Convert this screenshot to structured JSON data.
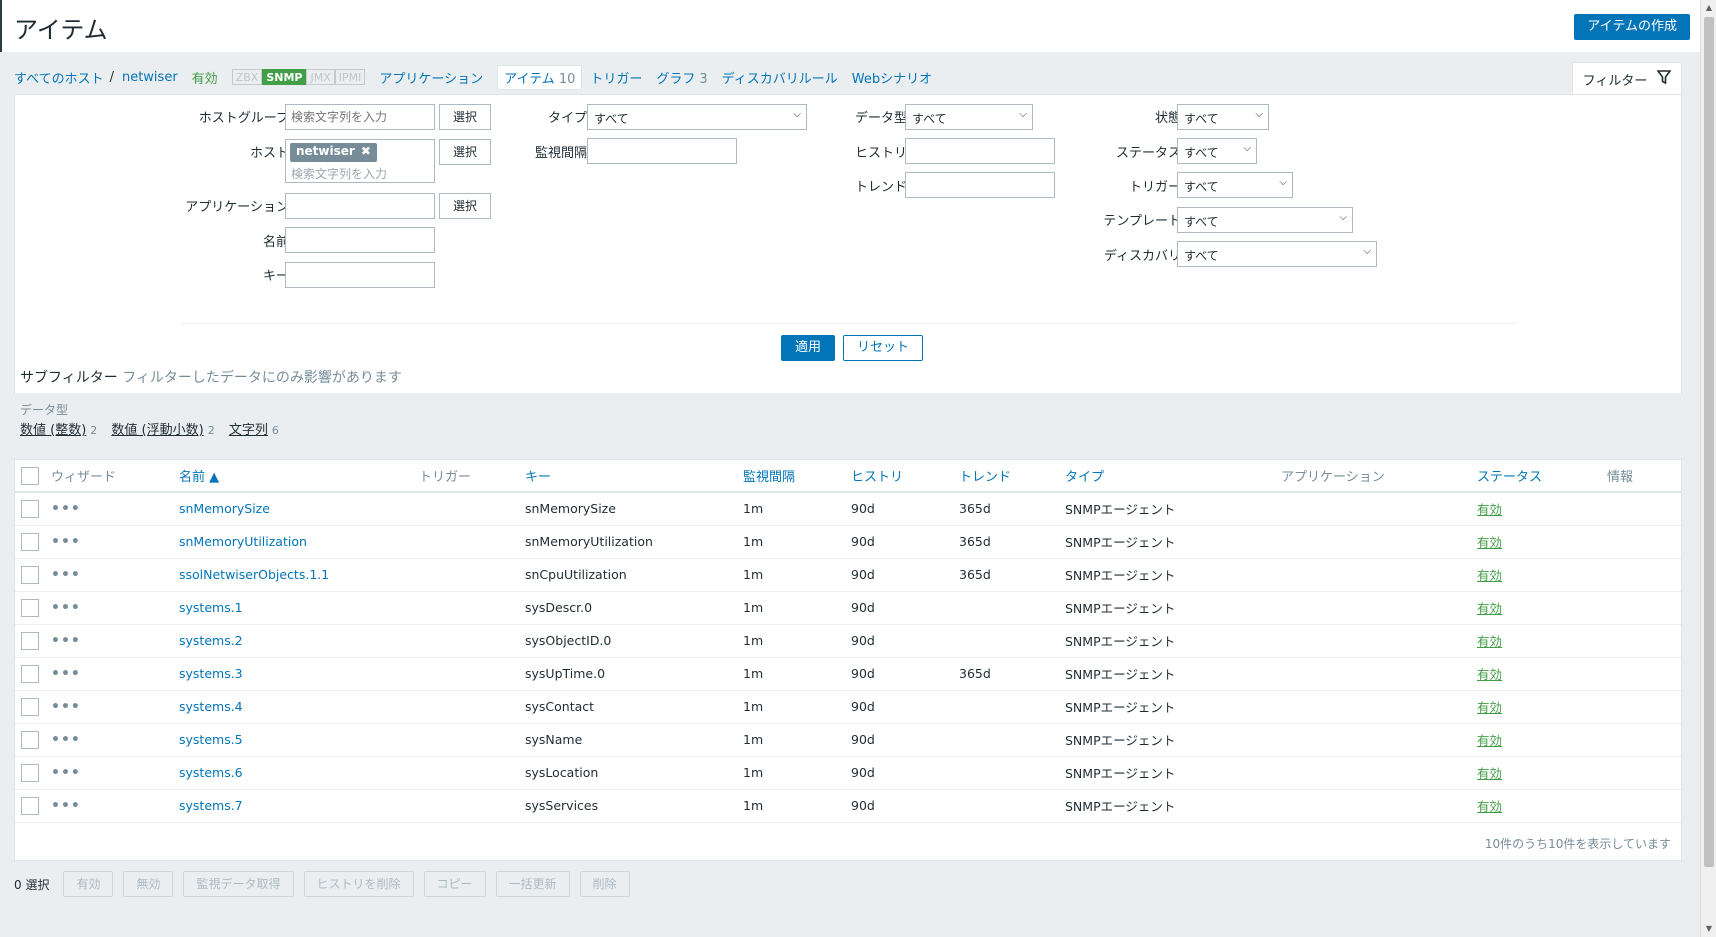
{
  "header": {
    "title": "アイテム",
    "create_button": "アイテムの作成"
  },
  "nav": {
    "all_hosts": "すべてのホスト",
    "separator": "/",
    "host": "netwiser",
    "status": "有効",
    "availability": [
      "ZBX",
      "SNMP",
      "JMX",
      "IPMI"
    ],
    "applications": "アプリケーション",
    "items": "アイテム",
    "items_count": "10",
    "triggers": "トリガー",
    "graphs": "グラフ",
    "graphs_count": "3",
    "discovery": "ディスカバリルール",
    "web": "Webシナリオ"
  },
  "filter": {
    "tab_label": "フィルター",
    "hostgroup_label": "ホストグループ",
    "hostgroup_placeholder": "検索文字列を入力",
    "host_label": "ホスト",
    "host_tag": "netwiser",
    "host_placeholder": "検索文字列を入力",
    "application_label": "アプリケーション",
    "name_label": "名前",
    "key_label": "キー",
    "select_button": "選択",
    "type_label": "タイプ",
    "type_value": "すべて",
    "interval_label": "監視間隔",
    "datatype_label": "データ型",
    "datatype_value": "すべて",
    "history_label": "ヒストリ",
    "trend_label": "トレンド",
    "state_label": "状態",
    "state_value": "すべて",
    "status_label": "ステータス",
    "status_value": "すべて",
    "triggers_label": "トリガー",
    "triggers_value": "すべて",
    "template_label": "テンプレート",
    "template_value": "すべて",
    "discovery_label": "ディスカバリ",
    "discovery_value": "すべて",
    "apply_button": "適用",
    "reset_button": "リセット"
  },
  "subfilter": {
    "title": "サブフィルター",
    "hint": "フィルターしたデータにのみ影響があります",
    "group_label": "データ型",
    "items": [
      {
        "label": "数値 (整数)",
        "count": "2"
      },
      {
        "label": "数値 (浮動小数)",
        "count": "2"
      },
      {
        "label": "文字列",
        "count": "6"
      }
    ]
  },
  "table": {
    "headers": {
      "wizard": "ウィザード",
      "name": "名前 ▲",
      "triggers": "トリガー",
      "key": "キー",
      "interval": "監視間隔",
      "history": "ヒストリ",
      "trends": "トレンド",
      "type": "タイプ",
      "applications": "アプリケーション",
      "status": "ステータス",
      "info": "情報"
    },
    "rows": [
      {
        "dots": "•••",
        "name": "snMemorySize",
        "key": "snMemorySize",
        "interval": "1m",
        "history": "90d",
        "trends": "365d",
        "type": "SNMPエージェント",
        "status": "有効"
      },
      {
        "dots": "•••",
        "name": "snMemoryUtilization",
        "key": "snMemoryUtilization",
        "interval": "1m",
        "history": "90d",
        "trends": "365d",
        "type": "SNMPエージェント",
        "status": "有効"
      },
      {
        "dots": "•••",
        "name": "ssolNetwiserObjects.1.1",
        "key": "snCpuUtilization",
        "interval": "1m",
        "history": "90d",
        "trends": "365d",
        "type": "SNMPエージェント",
        "status": "有効"
      },
      {
        "dots": "•••",
        "name": "systems.1",
        "key": "sysDescr.0",
        "interval": "1m",
        "history": "90d",
        "trends": "",
        "type": "SNMPエージェント",
        "status": "有効"
      },
      {
        "dots": "•••",
        "name": "systems.2",
        "key": "sysObjectID.0",
        "interval": "1m",
        "history": "90d",
        "trends": "",
        "type": "SNMPエージェント",
        "status": "有効"
      },
      {
        "dots": "•••",
        "name": "systems.3",
        "key": "sysUpTime.0",
        "interval": "1m",
        "history": "90d",
        "trends": "365d",
        "type": "SNMPエージェント",
        "status": "有効"
      },
      {
        "dots": "•••",
        "name": "systems.4",
        "key": "sysContact",
        "interval": "1m",
        "history": "90d",
        "trends": "",
        "type": "SNMPエージェント",
        "status": "有効"
      },
      {
        "dots": "•••",
        "name": "systems.5",
        "key": "sysName",
        "interval": "1m",
        "history": "90d",
        "trends": "",
        "type": "SNMPエージェント",
        "status": "有効"
      },
      {
        "dots": "•••",
        "name": "systems.6",
        "key": "sysLocation",
        "interval": "1m",
        "history": "90d",
        "trends": "",
        "type": "SNMPエージェント",
        "status": "有効"
      },
      {
        "dots": "•••",
        "name": "systems.7",
        "key": "sysServices",
        "interval": "1m",
        "history": "90d",
        "trends": "",
        "type": "SNMPエージェント",
        "status": "有効"
      }
    ],
    "footer": "10件のうち10件を表示しています"
  },
  "actions": {
    "selected": "0 選択",
    "buttons": [
      "有効",
      "無効",
      "監視データ取得",
      "ヒストリを削除",
      "コピー",
      "一括更新",
      "削除"
    ]
  },
  "colors": {
    "accent": "#0275b8",
    "enabled": "#429e47"
  }
}
